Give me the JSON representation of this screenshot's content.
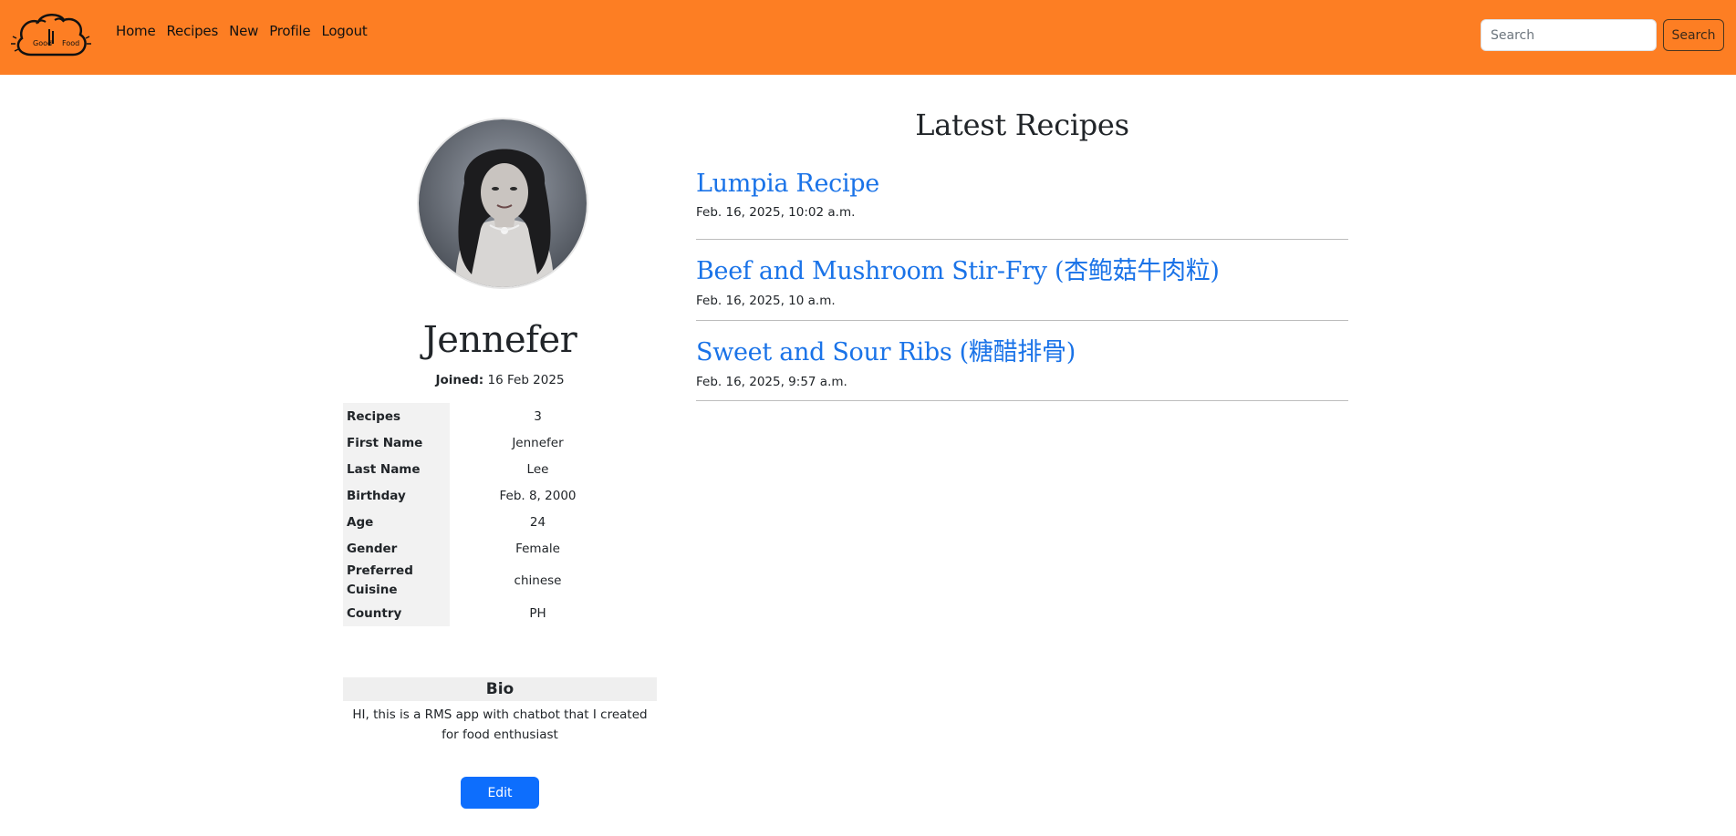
{
  "nav": {
    "logo_text_left": "Good",
    "logo_text_right": "Food",
    "links": [
      "Home",
      "Recipes",
      "New",
      "Profile",
      "Logout"
    ],
    "search_placeholder": "Search",
    "search_button": "Search"
  },
  "colors": {
    "navbar": "#fd7e23",
    "link": "#1a73e8",
    "button_primary": "#0d6efd"
  },
  "profile": {
    "name": "Jennefer",
    "joined_label": "Joined:",
    "joined_date": "16 Feb 2025",
    "details": [
      {
        "label": "Recipes",
        "value": "3"
      },
      {
        "label": "First Name",
        "value": "Jennefer"
      },
      {
        "label": "Last Name",
        "value": "Lee"
      },
      {
        "label": "Birthday",
        "value": "Feb. 8, 2000"
      },
      {
        "label": "Age",
        "value": "24"
      },
      {
        "label": "Gender",
        "value": "Female"
      },
      {
        "label": "Preferred Cuisine",
        "value": "chinese"
      },
      {
        "label": "Country",
        "value": "PH"
      }
    ],
    "bio_heading": "Bio",
    "bio_text": "HI, this is a RMS app with chatbot that I created for food enthusiast",
    "edit_button": "Edit"
  },
  "latest": {
    "heading": "Latest Recipes",
    "recipes": [
      {
        "title": "Lumpia Recipe",
        "date": "Feb. 16, 2025, 10:02 a.m."
      },
      {
        "title": "Beef and Mushroom Stir-Fry (杏鲍菇牛肉粒)",
        "date": "Feb. 16, 2025, 10 a.m."
      },
      {
        "title": "Sweet and Sour Ribs (糖醋排骨)",
        "date": "Feb. 16, 2025, 9:57 a.m."
      }
    ]
  }
}
